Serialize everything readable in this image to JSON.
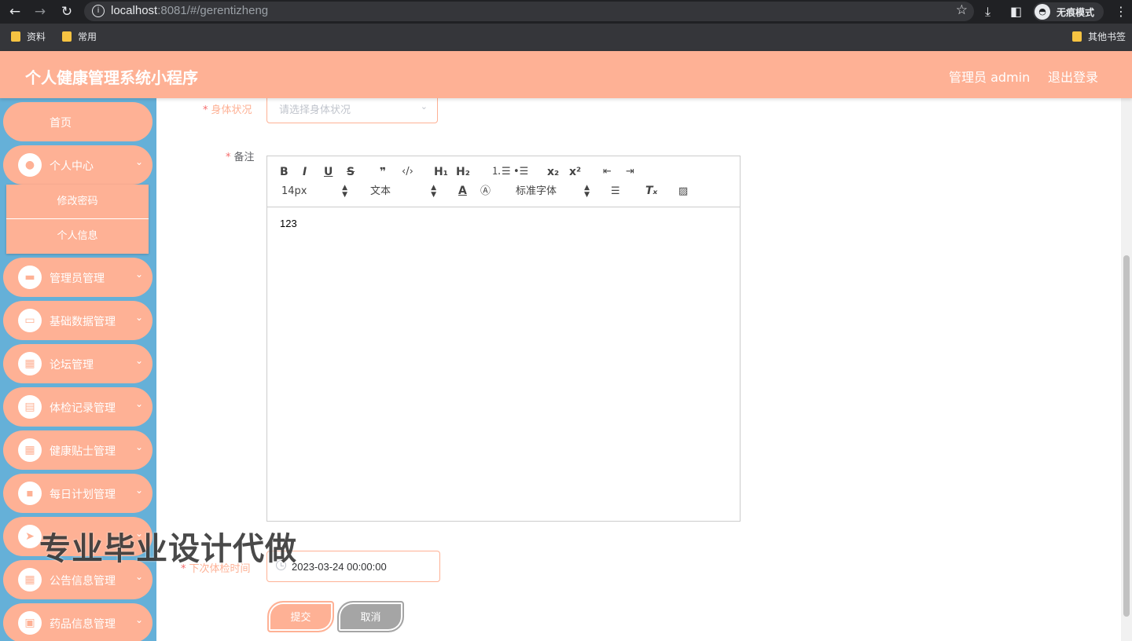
{
  "browser": {
    "url_host": "localhost",
    "url_rest": ":8081/#/gerentizheng",
    "incognito_label": "无痕模式",
    "bookmarks": [
      "资料",
      "常用"
    ],
    "other_bookmarks": "其他书签"
  },
  "header": {
    "title": "个人健康管理系统小程序",
    "admin_label": "管理员 admin",
    "logout_label": "退出登录"
  },
  "sidebar": {
    "home": "首页",
    "personal_center": "个人中心",
    "submenu": [
      "修改密码",
      "个人信息"
    ],
    "items": [
      {
        "label": "管理员管理",
        "icon": "ticket-icon"
      },
      {
        "label": "基础数据管理",
        "icon": "monitor-icon"
      },
      {
        "label": "论坛管理",
        "icon": "grid-icon"
      },
      {
        "label": "体检记录管理",
        "icon": "chart-icon"
      },
      {
        "label": "健康贴士管理",
        "icon": "grid-icon"
      },
      {
        "label": "每日计划管理",
        "icon": "message-icon"
      },
      {
        "label": "",
        "icon": "send-icon"
      },
      {
        "label": "公告信息管理",
        "icon": "grid-icon"
      },
      {
        "label": "药品信息管理",
        "icon": "clipboard-icon"
      }
    ]
  },
  "form": {
    "body_status_label": "身体状况",
    "body_status_placeholder": "请选择身体状况",
    "remark_label": "备注",
    "editor": {
      "font_size": "14px",
      "block_type": "文本",
      "font_family": "标准字体",
      "content": "123"
    },
    "next_exam_label": "下次体检时间",
    "next_exam_value": "2023-03-24 00:00:00",
    "submit_label": "提交",
    "cancel_label": "取消"
  },
  "watermark": "专业毕业设计代做",
  "colors": {
    "accent": "#feb195",
    "sidebar_bg": "#65b0d8",
    "required": "#f56c6c"
  }
}
